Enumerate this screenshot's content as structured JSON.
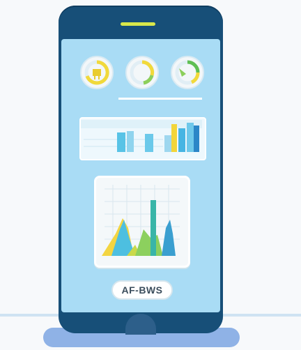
{
  "button": {
    "label": "AF-BWS"
  },
  "colors": {
    "phone_body": "#174f78",
    "screen": "#a9dcf5",
    "speaker": "#d9e84a",
    "stand": "#8fb2e6"
  },
  "icons": {
    "gauge_1": "gauge-ring-icon",
    "gauge_2": "gauge-ring-icon",
    "gauge_3": "gauge-ring-icon"
  }
}
